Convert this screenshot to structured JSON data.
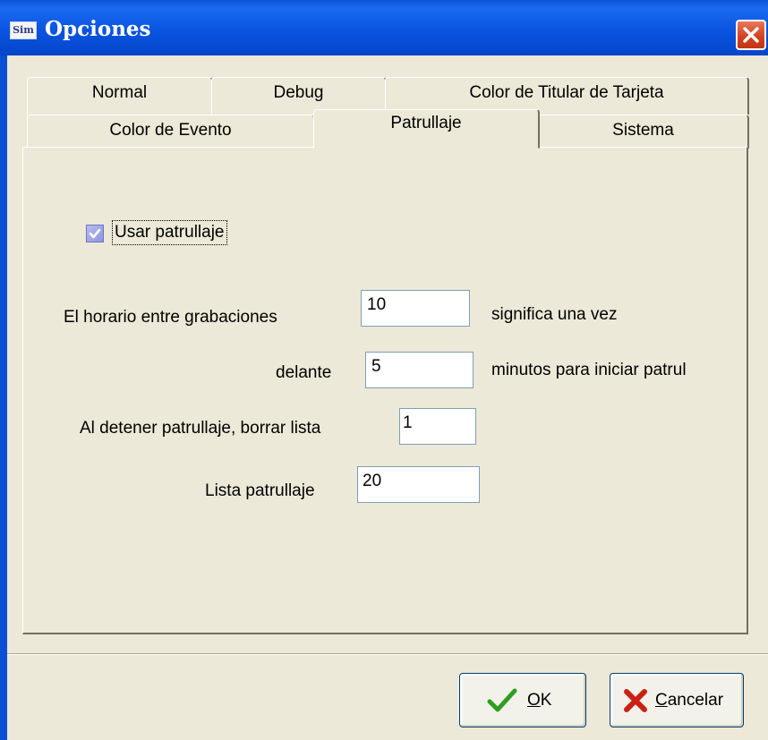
{
  "window": {
    "title": "Opciones",
    "icon_text": "Sim",
    "close_icon": "close-icon"
  },
  "tabs": {
    "row1": [
      "Normal",
      "Debug",
      "Color de Titular de Tarjeta"
    ],
    "row2": [
      "Color de Evento",
      "Patrullaje",
      "Sistema"
    ],
    "active": "Patrullaje"
  },
  "form": {
    "use_patrol": {
      "label": "Usar patrullaje",
      "checked": true
    },
    "interval": {
      "label": "El horario entre grabaciones",
      "value": "10",
      "suffix": "significa una vez"
    },
    "before": {
      "label": "delante",
      "value": "5",
      "suffix": "minutos para iniciar patrul"
    },
    "clear_list": {
      "label": "Al detener patrullaje, borrar lista",
      "value": "1"
    },
    "patrol_list": {
      "label": "Lista patrullaje",
      "value": "20"
    }
  },
  "buttons": {
    "ok": {
      "accel": "O",
      "rest": "K",
      "icon": "checkmark-icon"
    },
    "cancel": {
      "accel": "C",
      "rest": "ancelar",
      "icon": "red-x-icon"
    }
  },
  "colors": {
    "titlebar": "#0a55d8",
    "dialog_bg": "#ece9d8",
    "close_button": "#d2401e",
    "checkbox_fill": "#9aa0e6",
    "ok_check": "#2f9e1f",
    "cancel_x": "#cc1f13"
  }
}
